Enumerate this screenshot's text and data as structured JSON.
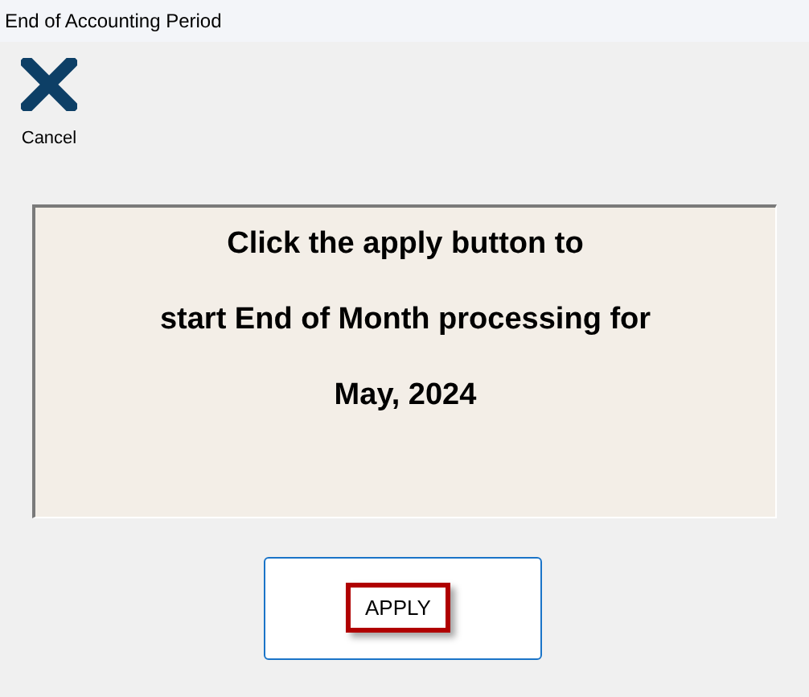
{
  "window": {
    "title": "End of Accounting Period"
  },
  "toolbar": [
    {
      "label": "Cancel",
      "kind": "cancel"
    }
  ],
  "message": {
    "lines": [
      "Click the apply button to",
      "start End of Month processing for",
      "May, 2024"
    ]
  },
  "apply_button": {
    "label": "APPLY",
    "focused": true
  }
}
